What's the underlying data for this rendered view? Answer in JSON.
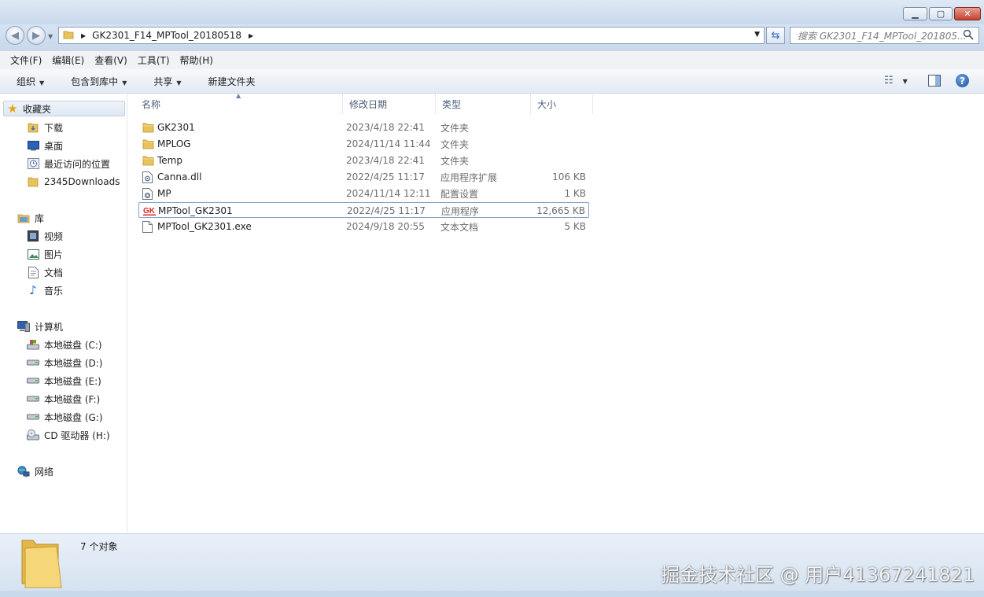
{
  "window": {
    "path_segment": "GK2301_F14_MPTool_20180518",
    "search_placeholder": "搜索 GK2301_F14_MPTool_201805..."
  },
  "menu": [
    {
      "label": "文件(F)"
    },
    {
      "label": "编辑(E)"
    },
    {
      "label": "查看(V)"
    },
    {
      "label": "工具(T)"
    },
    {
      "label": "帮助(H)"
    }
  ],
  "toolbar": {
    "organize": "组织",
    "include_library": "包含到库中",
    "share": "共享",
    "new_folder": "新建文件夹"
  },
  "nav": {
    "favorites": "收藏夹",
    "downloads": "下载",
    "desktop": "桌面",
    "recent": "最近访问的位置",
    "downloads2345": "2345Downloads",
    "library": "库",
    "videos": "视频",
    "pictures": "图片",
    "documents": "文档",
    "music": "音乐",
    "computer": "计算机",
    "drive_c": "本地磁盘 (C:)",
    "drive_d": "本地磁盘 (D:)",
    "drive_e": "本地磁盘 (E:)",
    "drive_f": "本地磁盘 (F:)",
    "drive_g": "本地磁盘 (G:)",
    "drive_h": "CD 驱动器 (H:)",
    "network": "网络"
  },
  "columns": {
    "name": "名称",
    "date": "修改日期",
    "type": "类型",
    "size": "大小"
  },
  "files": [
    {
      "name": "GK2301",
      "date": "2023/4/18 22:41",
      "type": "文件夹",
      "size": "",
      "icon": "folder-icon"
    },
    {
      "name": "MPLOG",
      "date": "2024/11/14 11:44",
      "type": "文件夹",
      "size": "",
      "icon": "folder-icon"
    },
    {
      "name": "Temp",
      "date": "2023/4/18 22:41",
      "type": "文件夹",
      "size": "",
      "icon": "folder-icon"
    },
    {
      "name": "Canna.dll",
      "date": "2022/4/25 11:17",
      "type": "应用程序扩展",
      "size": "106 KB",
      "icon": "dll-file-icon"
    },
    {
      "name": "MP",
      "date": "2024/11/14 12:11",
      "type": "配置设置",
      "size": "1 KB",
      "icon": "config-file-icon"
    },
    {
      "name": "MPTool_GK2301",
      "date": "2022/4/25 11:17",
      "type": "应用程序",
      "size": "12,665 KB",
      "icon": "gk-app-icon",
      "selected": true
    },
    {
      "name": "MPTool_GK2301.exe",
      "date": "2024/9/18 20:55",
      "type": "文本文档",
      "size": "5 KB",
      "icon": "text-file-icon"
    }
  ],
  "status": {
    "count": "7 个对象"
  },
  "watermark": "掘金技术社区 @ 用户41367241821",
  "colors": {
    "folder": "#e8c25a",
    "gk_logo": "#d9261c",
    "selection_border": "#7da2ce"
  }
}
